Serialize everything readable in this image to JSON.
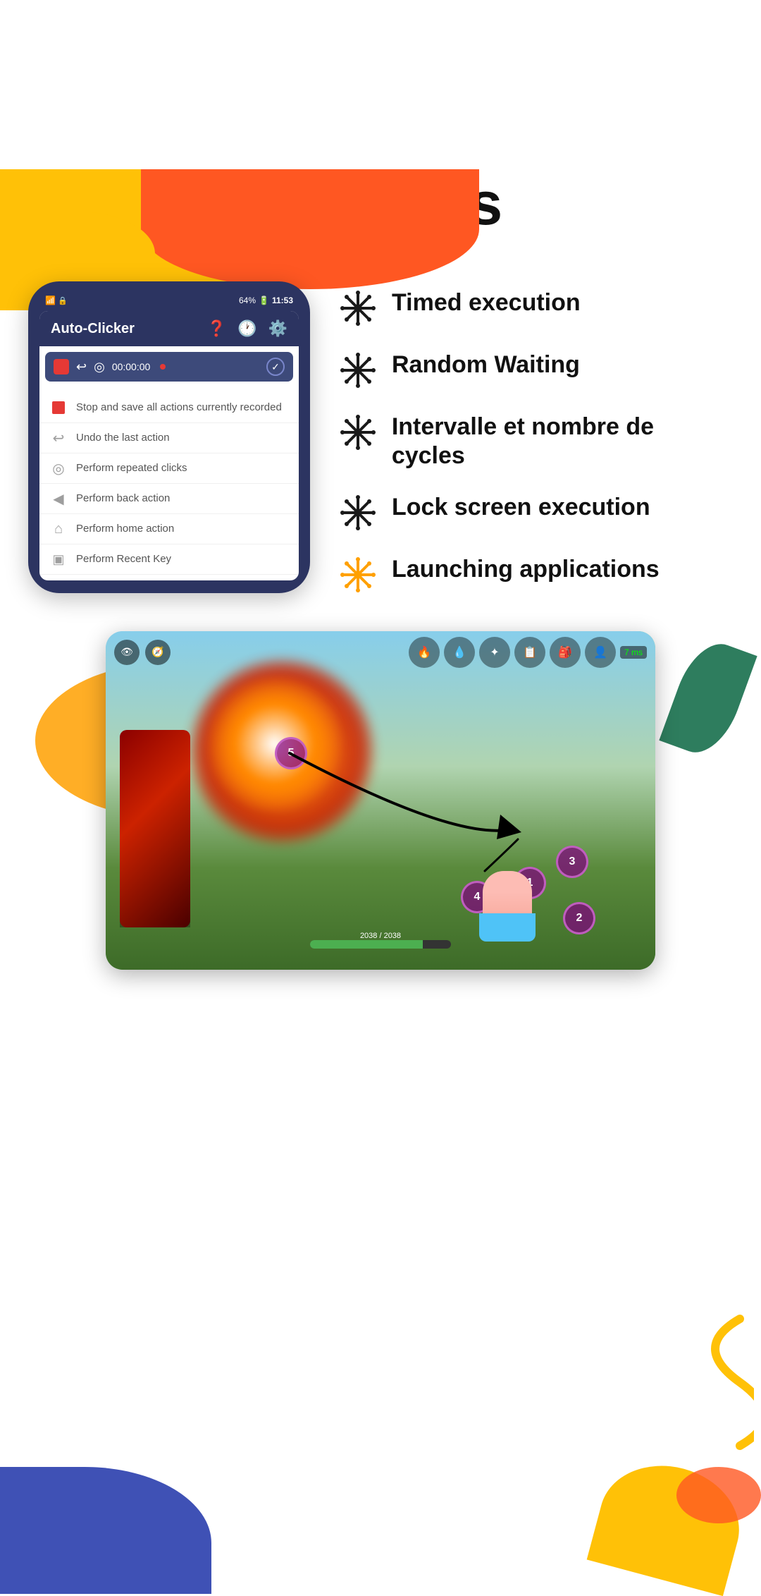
{
  "page": {
    "title": "Features",
    "background_color": "#ffffff"
  },
  "decorative": {
    "blob_colors": {
      "yellow": "#FFC107",
      "orange": "#FF5722",
      "green": "#2E7D5E",
      "blue": "#3F51B5",
      "orange_mid": "#FFA000"
    }
  },
  "phone": {
    "app_name": "Auto-Clicker",
    "status_bar": {
      "battery": "64%",
      "time": "11:53",
      "signal": "📶"
    },
    "toolbar": {
      "timer": "00:00:00"
    },
    "menu_items": [
      {
        "icon": "stop-icon",
        "icon_color": "red",
        "text": "Stop and save all actions currently recorded"
      },
      {
        "icon": "undo-icon",
        "icon_color": "grey",
        "text": "Undo the last action"
      },
      {
        "icon": "target-icon",
        "icon_color": "grey",
        "text": "Perform repeated clicks"
      },
      {
        "icon": "back-icon",
        "icon_color": "grey",
        "text": "Perform back action"
      },
      {
        "icon": "home-icon",
        "icon_color": "grey",
        "text": "Perform home action"
      },
      {
        "icon": "recent-icon",
        "icon_color": "grey",
        "text": "Perform Recent Key"
      }
    ]
  },
  "features": [
    {
      "id": "timed",
      "label": "Timed execution"
    },
    {
      "id": "random",
      "label": "Random Waiting"
    },
    {
      "id": "interval",
      "label": "Intervalle et nombre de cycles"
    },
    {
      "id": "lock",
      "label": "Lock screen execution"
    },
    {
      "id": "launch",
      "label": "Launching applications"
    }
  ],
  "game": {
    "health_text": "2038 / 2038",
    "ping": "7 ms",
    "click_points": [
      "5",
      "4",
      "3",
      "2",
      "1"
    ]
  }
}
